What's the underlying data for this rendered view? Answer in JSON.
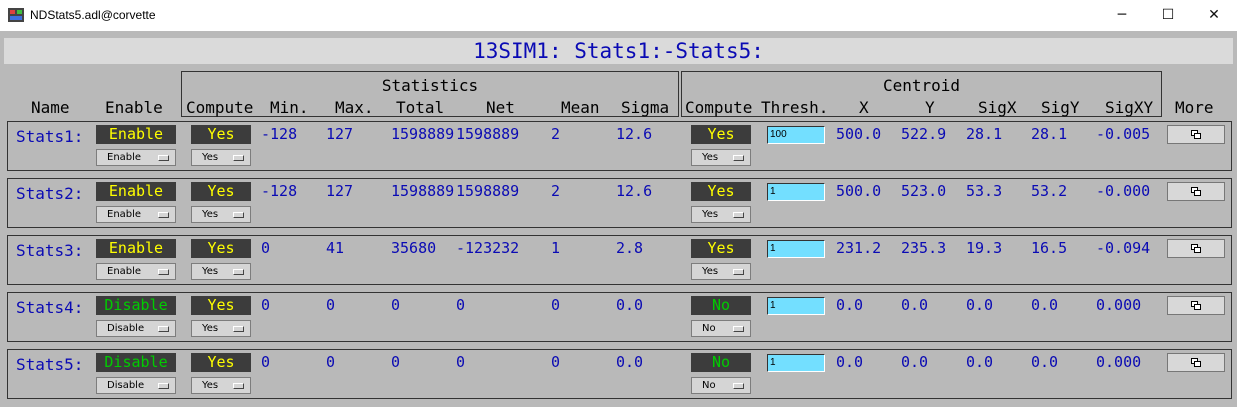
{
  "window": {
    "title": "NDStats5.adl@corvette",
    "min_glyph": "─",
    "max_glyph": "☐",
    "close_glyph": "✕"
  },
  "heading": "13SIM1: Stats1:-Stats5:",
  "groups": {
    "statistics": "Statistics",
    "centroid": "Centroid"
  },
  "headers": {
    "name": "Name",
    "enable": "Enable",
    "compute": "Compute",
    "min": "Min.",
    "max": "Max.",
    "total": "Total",
    "net": "Net",
    "mean": "Mean",
    "sigma": "Sigma",
    "compute2": "Compute",
    "thresh": "Thresh.",
    "x": "X",
    "y": "Y",
    "sigx": "SigX",
    "sigy": "SigY",
    "sigxy": "SigXY",
    "more": "More"
  },
  "rows": [
    {
      "name": "Stats1:",
      "enable": "Enable",
      "enable_menu": "Enable",
      "compute": "Yes",
      "compute_menu": "Yes",
      "min": "-128",
      "max": "127",
      "total": "1598889",
      "net": "1598889",
      "mean": "2",
      "sigma": "12.6",
      "centroid_compute": "Yes",
      "centroid_menu": "Yes",
      "thresh": "100",
      "x": "500.0",
      "y": "522.9",
      "sigx": "28.1",
      "sigy": "28.1",
      "sigxy": "-0.005"
    },
    {
      "name": "Stats2:",
      "enable": "Enable",
      "enable_menu": "Enable",
      "compute": "Yes",
      "compute_menu": "Yes",
      "min": "-128",
      "max": "127",
      "total": "1598889",
      "net": "1598889",
      "mean": "2",
      "sigma": "12.6",
      "centroid_compute": "Yes",
      "centroid_menu": "Yes",
      "thresh": "1",
      "x": "500.0",
      "y": "523.0",
      "sigx": "53.3",
      "sigy": "53.2",
      "sigxy": "-0.000"
    },
    {
      "name": "Stats3:",
      "enable": "Enable",
      "enable_menu": "Enable",
      "compute": "Yes",
      "compute_menu": "Yes",
      "min": "0",
      "max": "41",
      "total": "35680",
      "net": "-123232",
      "mean": "1",
      "sigma": "2.8",
      "centroid_compute": "Yes",
      "centroid_menu": "Yes",
      "thresh": "1",
      "x": "231.2",
      "y": "235.3",
      "sigx": "19.3",
      "sigy": "16.5",
      "sigxy": "-0.094"
    },
    {
      "name": "Stats4:",
      "enable": "Disable",
      "enable_menu": "Disable",
      "compute": "Yes",
      "compute_menu": "Yes",
      "min": "0",
      "max": "0",
      "total": "0",
      "net": "0",
      "mean": "0",
      "sigma": "0.0",
      "centroid_compute": "No",
      "centroid_menu": "No",
      "thresh": "1",
      "x": "0.0",
      "y": "0.0",
      "sigx": "0.0",
      "sigy": "0.0",
      "sigxy": "0.000"
    },
    {
      "name": "Stats5:",
      "enable": "Disable",
      "enable_menu": "Disable",
      "compute": "Yes",
      "compute_menu": "Yes",
      "min": "0",
      "max": "0",
      "total": "0",
      "net": "0",
      "mean": "0",
      "sigma": "0.0",
      "centroid_compute": "No",
      "centroid_menu": "No",
      "thresh": "1",
      "x": "0.0",
      "y": "0.0",
      "sigx": "0.0",
      "sigy": "0.0",
      "sigxy": "0.000"
    }
  ],
  "colors": {
    "value_blue": "#0a0ab4",
    "indicator_yellow": "#ffff00",
    "indicator_green": "#00cc00",
    "indicator_bg": "#3c3c3c",
    "thresh_bg": "#73dfff",
    "panel_bg": "#b9b9b9"
  },
  "icons": {
    "app": "app-icon",
    "more": "related-display-icon"
  }
}
